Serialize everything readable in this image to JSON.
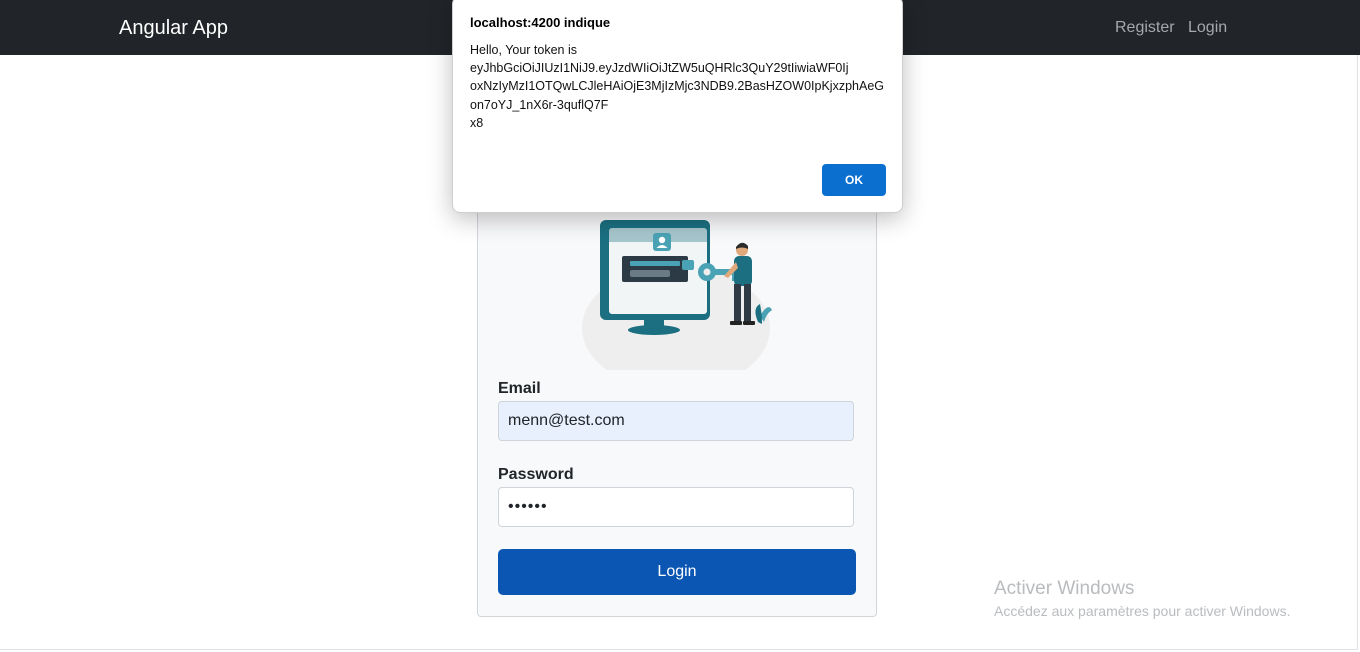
{
  "navbar": {
    "brand": "Angular App",
    "links": [
      "Register",
      "Login"
    ]
  },
  "login_form": {
    "email_label": "Email",
    "email_value": "menn@test.com",
    "password_label": "Password",
    "password_value": "••••••",
    "submit_label": "Login"
  },
  "alert_dialog": {
    "title": "localhost:4200 indique",
    "message_lines": [
      "Hello, Your token is",
      "eyJhbGciOiJIUzI1NiJ9.eyJzdWIiOiJtZW5uQHRlc3QuY29tIiwiaWF0Ij",
      "oxNzIyMzI1OTQwLCJleHAiOjE3MjIzMjc3NDB9.2BasHZOW0IpKjxzphAeG",
      "on7oYJ_1nX6r-3quflQ7F",
      "x8"
    ],
    "ok_label": "OK"
  },
  "watermark": {
    "title": "Activer Windows",
    "subtitle": "Accédez aux paramètres pour activer Windows."
  },
  "colors": {
    "navbar_bg": "#212529",
    "primary_button": "#0b55b3",
    "dialog_ok": "#0b6fd0",
    "illustration_teal": "#1b6f80"
  },
  "icons": [
    "user-icon",
    "key-icon"
  ]
}
